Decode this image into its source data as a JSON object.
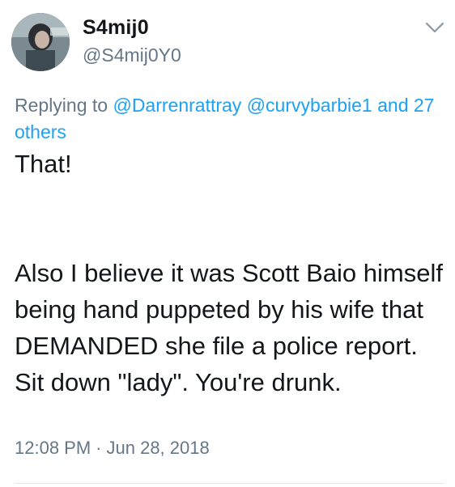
{
  "user": {
    "display_name": "S4mij0",
    "handle": "@S4mij0Y0"
  },
  "reply": {
    "prefix": "Replying to",
    "mention_1": "@Darrenrattray",
    "mention_2": "@curvybarbie1",
    "others": "and 27 others"
  },
  "tweet": {
    "line_1": "That!",
    "paragraph_2": "Also I believe it was Scott Baio himself being hand puppeted by his wife that DEMANDED she file a police report. Sit down \"lady\". You're drunk."
  },
  "meta": {
    "time": "12:08 PM",
    "separator": "·",
    "date": "Jun 28, 2018"
  },
  "icons": {
    "menu": "chevron-down-icon",
    "avatar": "avatar"
  },
  "colors": {
    "link": "#1da1f2",
    "secondary_text": "#657786",
    "primary_text": "#14171a",
    "divider": "#e1e8ed"
  }
}
